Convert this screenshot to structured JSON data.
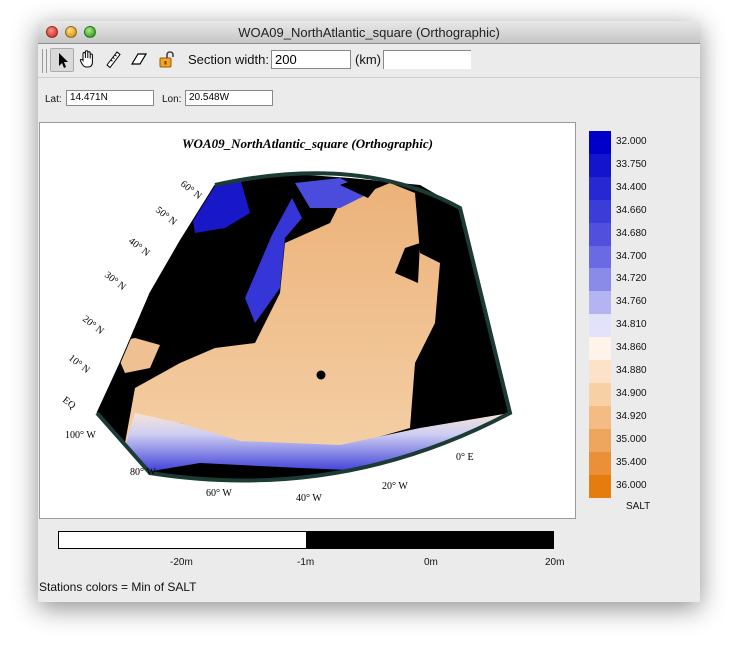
{
  "window": {
    "title": "WOA09_NorthAtlantic_square (Orthographic)"
  },
  "toolbar": {
    "tools": [
      {
        "name": "arrow",
        "icon": "arrow-pointer-icon",
        "selected": true
      },
      {
        "name": "pan",
        "icon": "hand-icon"
      },
      {
        "name": "ruler",
        "icon": "ruler-icon"
      },
      {
        "name": "section",
        "icon": "section-icon"
      },
      {
        "name": "lock",
        "icon": "lock-icon"
      }
    ],
    "section_label": "Section width:",
    "section_value": "200",
    "section_unit": "(km)",
    "extra_value": ""
  },
  "coords": {
    "lat_label": "Lat:",
    "lat_value": "14.471N",
    "lon_label": "Lon:",
    "lon_value": "20.548W"
  },
  "map": {
    "title": "WOA09_NorthAtlantic_square (Orthographic)",
    "lat_labels": [
      "60° N",
      "50° N",
      "40° N",
      "30° N",
      "20° N",
      "10° N",
      "EQ"
    ],
    "lon_labels": [
      "100° W",
      "80° W",
      "60° W",
      "40° W",
      "20° W",
      "0° E"
    ],
    "variable": "SALT",
    "colorbar": {
      "labels": [
        "32.000",
        "33.750",
        "34.400",
        "34.660",
        "34.680",
        "34.700",
        "34.720",
        "34.760",
        "34.810",
        "34.860",
        "34.880",
        "34.900",
        "34.920",
        "35.000",
        "35.400",
        "36.000"
      ],
      "colors": [
        "#0000c8",
        "#1414cd",
        "#2828d2",
        "#3c3cd7",
        "#5050dc",
        "#6a6ae2",
        "#8a8ae9",
        "#b4b4f2",
        "#e2e2fb",
        "#fff4ea",
        "#fbe2c8",
        "#f7d0a6",
        "#f3bc84",
        "#eea65e",
        "#e99038",
        "#e47c10"
      ]
    }
  },
  "depth_scale": {
    "labels": [
      "-20m",
      "-1m",
      "0m",
      "20m"
    ]
  },
  "footer": {
    "text": "Stations colors = Min of SALT"
  }
}
